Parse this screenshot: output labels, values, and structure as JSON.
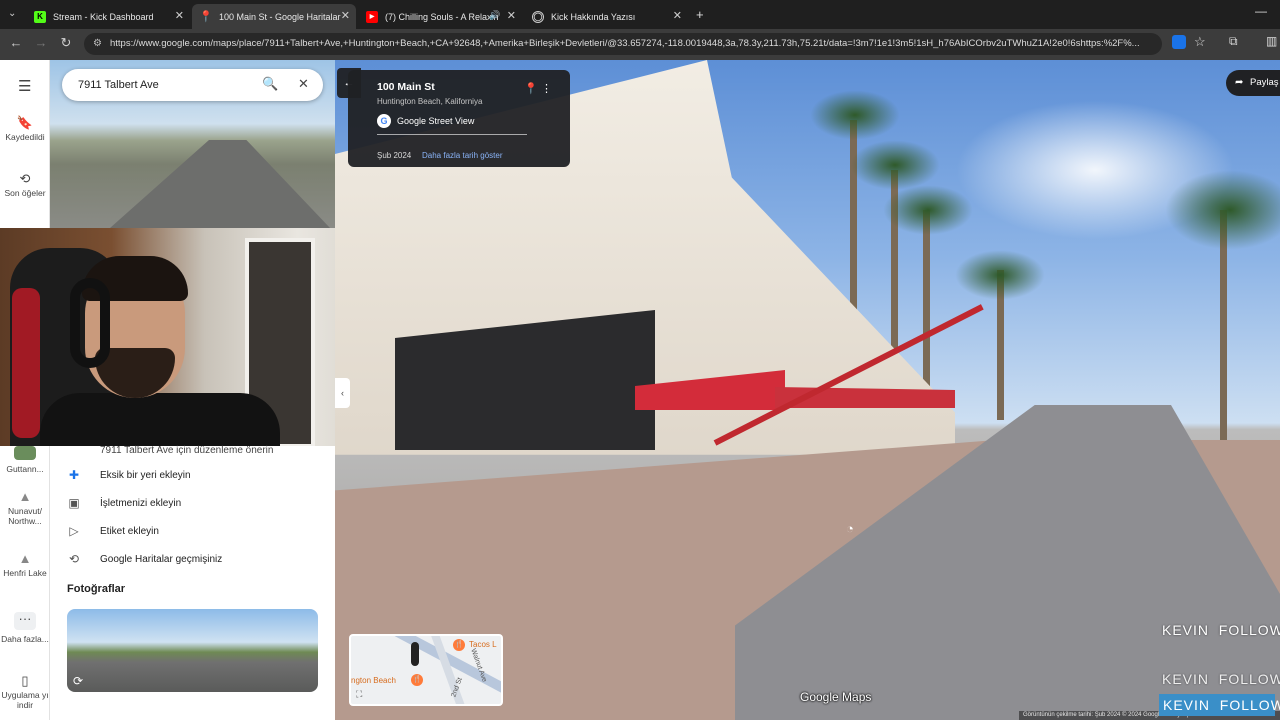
{
  "browser": {
    "tabs": [
      {
        "title": "Stream - Kick Dashboard",
        "icon": "kick-icon",
        "active": false
      },
      {
        "title": "100 Main St - Google Haritalar",
        "icon": "maps-pin-icon",
        "active": true
      },
      {
        "title": "(7) Chilling Souls - A Relaxin",
        "icon": "youtube-icon",
        "active": false
      },
      {
        "title": "Kick Hakkında Yazısı",
        "icon": "globe-icon",
        "active": false
      }
    ],
    "url": "https://www.google.com/maps/place/7911+Talbert+Ave,+Huntington+Beach,+CA+92648,+Amerika+Birleşik+Devletleri/@33.657274,-118.0019448,3a,78.3y,211.73h,75.21t/data=!3m7!1e1!3m5!1sH_h76AbICOrbv2uTWhuZ1A!2e0!6shttps:%2F%..."
  },
  "rail": {
    "saved_label": "Kaydedildi",
    "recent_label": "Son öğeler",
    "recents": [
      {
        "label": "Guttann..."
      },
      {
        "label": "Nunavut/ Northw..."
      },
      {
        "label": "Henfri Lake"
      },
      {
        "label": "Daha fazla..."
      }
    ],
    "download_label": "Uygulama yı indir"
  },
  "panel": {
    "search_value": "7911 Talbert Ave",
    "cut_text": "7911 Talbert Ave için düzenleme önerin",
    "actions": [
      {
        "label": "Eksik bir yeri ekleyin",
        "icon": "add-place-icon"
      },
      {
        "label": "İşletmenizi ekleyin",
        "icon": "business-icon"
      },
      {
        "label": "Etiket ekleyin",
        "icon": "label-icon"
      },
      {
        "label": "Google Haritalar geçmişiniz",
        "icon": "history-icon"
      }
    ],
    "photos_title": "Fotoğraflar"
  },
  "streetview": {
    "title": "100 Main St",
    "subtitle": "Huntington Beach, Kaliforniya",
    "brand": "Google Street View",
    "date": "Şub 2024",
    "more_dates": "Daha fazla tarih göster",
    "share": "Paylaş",
    "logo": "Google Maps",
    "attribution": "Görüntünün çekilme tarihi: Şub 2024   © 2024 Google   Türkiye   Şartlar",
    "minimap_labels": [
      "Tacos L",
      "ngton Beach",
      "2nd St",
      "Walnut Ave"
    ]
  },
  "overlays": {
    "follow_1": "KEVIN  FOLLOW",
    "follow_2": "KEVIN  FOLLOW",
    "follow_3": "KEVIN  FOLLOW"
  }
}
